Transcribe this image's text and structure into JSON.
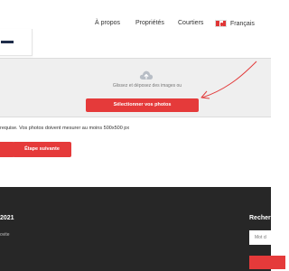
{
  "nav": {
    "items": [
      "À propos",
      "Propriétés",
      "Courtiers"
    ],
    "language": "Français"
  },
  "upload": {
    "drop_text": "Glissez et déposez des images ou",
    "select_button": "Sélectionner vos photos"
  },
  "requirement_text": "requise. Vos photos doivent mesurer au moins 500x500 px",
  "actions": {
    "next_button": "Étape suivante"
  },
  "footer": {
    "year_text": "2021",
    "sub_text": "ovite",
    "search_heading": "Recherc",
    "search_placeholder": "Mot cl"
  },
  "colors": {
    "accent": "#e53a3a",
    "footer_bg": "#272727",
    "dropzone_bg": "#efefef"
  },
  "icons": [
    "canada-flag-icon",
    "cloud-upload-icon",
    "arrow-annotation-icon"
  ]
}
